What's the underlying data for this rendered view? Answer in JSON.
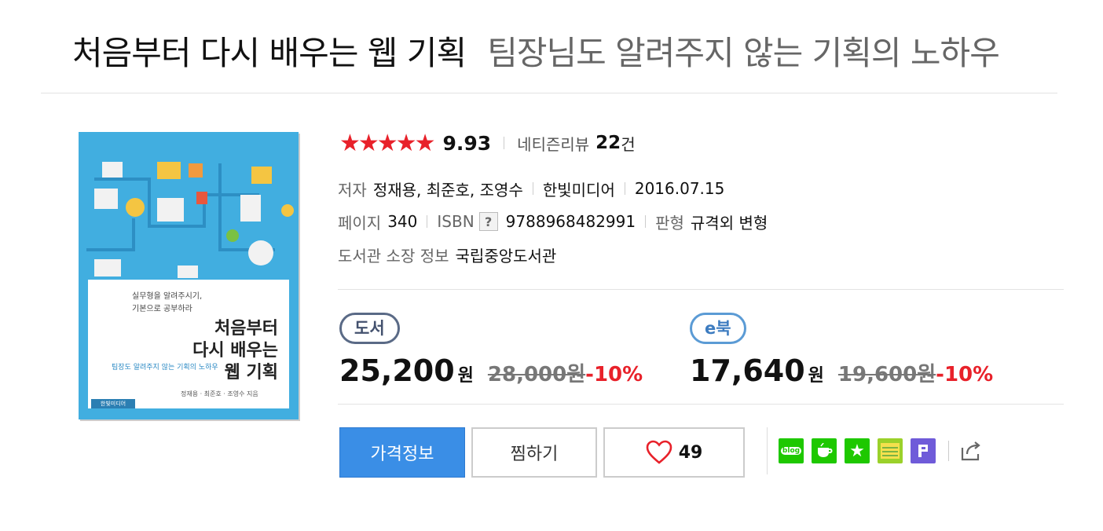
{
  "title": {
    "main": "처음부터 다시 배우는 웹 기획",
    "sub": "팀장님도 알려주지 않는 기획의 노하우"
  },
  "cover": {
    "small1": "실무형을 알려주시기,",
    "small2": "기본으로 공부하라",
    "t1": "처음부터",
    "t2": "다시 배우는",
    "t3": "웹 기획",
    "tag": "팀장도 알려주지 않는 기획의 노하우",
    "authors": "정재용 · 최준호 · 조영수 지음",
    "publisher": "한빛미디어"
  },
  "rating": {
    "stars": "★★★★★",
    "score": "9.93",
    "review_label": "네티즌리뷰",
    "review_count": "22",
    "review_unit": "건"
  },
  "meta": {
    "author_label": "저자",
    "author_value": "정재용, 최준호, 조영수",
    "publisher": "한빛미디어",
    "date": "2016.07.15",
    "page_label": "페이지",
    "page_value": "340",
    "isbn_label": "ISBN",
    "isbn_help": "?",
    "isbn_value": "9788968482991",
    "format_label": "판형",
    "format_value": "규격외 변형",
    "library_label": "도서관 소장 정보",
    "library_value": "국립중앙도서관"
  },
  "price_book": {
    "badge": "도서",
    "price": "25,200",
    "unit": "원",
    "original": "28,000원",
    "discount": "-10%"
  },
  "price_ebook": {
    "badge": "e북",
    "price": "17,640",
    "unit": "원",
    "original": "19,600원",
    "discount": "-10%"
  },
  "actions": {
    "price_info": "가격정보",
    "wish": "찜하기",
    "like_count": "49"
  },
  "share": {
    "blog": "blog"
  },
  "colors": {
    "accent": "#3a8ee6",
    "star": "#e8212a",
    "discount": "#e8212a"
  }
}
